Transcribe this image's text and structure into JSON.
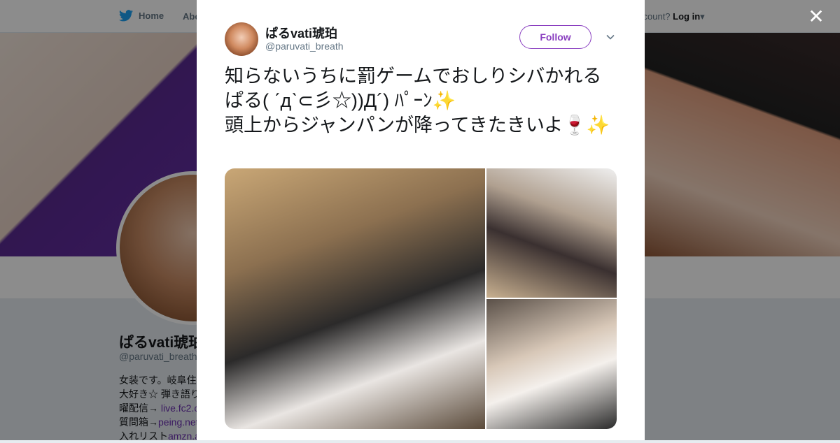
{
  "nav": {
    "home_label": "Home",
    "about_label": "Abo",
    "account_prompt": "ccount?",
    "login_label": "Log in"
  },
  "profile": {
    "name": "ぱるvati琥珀",
    "handle": "@paruvati_breath",
    "bio_lines": [
      "女装です。岐阜住",
      "大好き☆ 弾き語り",
      "曜配信→ ",
      "質問箱→",
      "入れリスト"
    ],
    "bio_links": [
      "live.fc2.c",
      "peing.net",
      "amzn.a"
    ]
  },
  "tweet": {
    "author_name": "ぱるvati琥珀",
    "author_handle": "@paruvati_breath",
    "follow_label": "Follow",
    "text": "知らないうちに罰ゲームでおしりシバかれるぱる( ˊдˋ⊂彡☆))Д´) ﾊﾟｰﾝ✨\n頭上からジャンパンが降ってきたきいよ🍷✨"
  },
  "colors": {
    "accent": "#8a3fc0",
    "twitter_blue": "#1da1f2"
  }
}
